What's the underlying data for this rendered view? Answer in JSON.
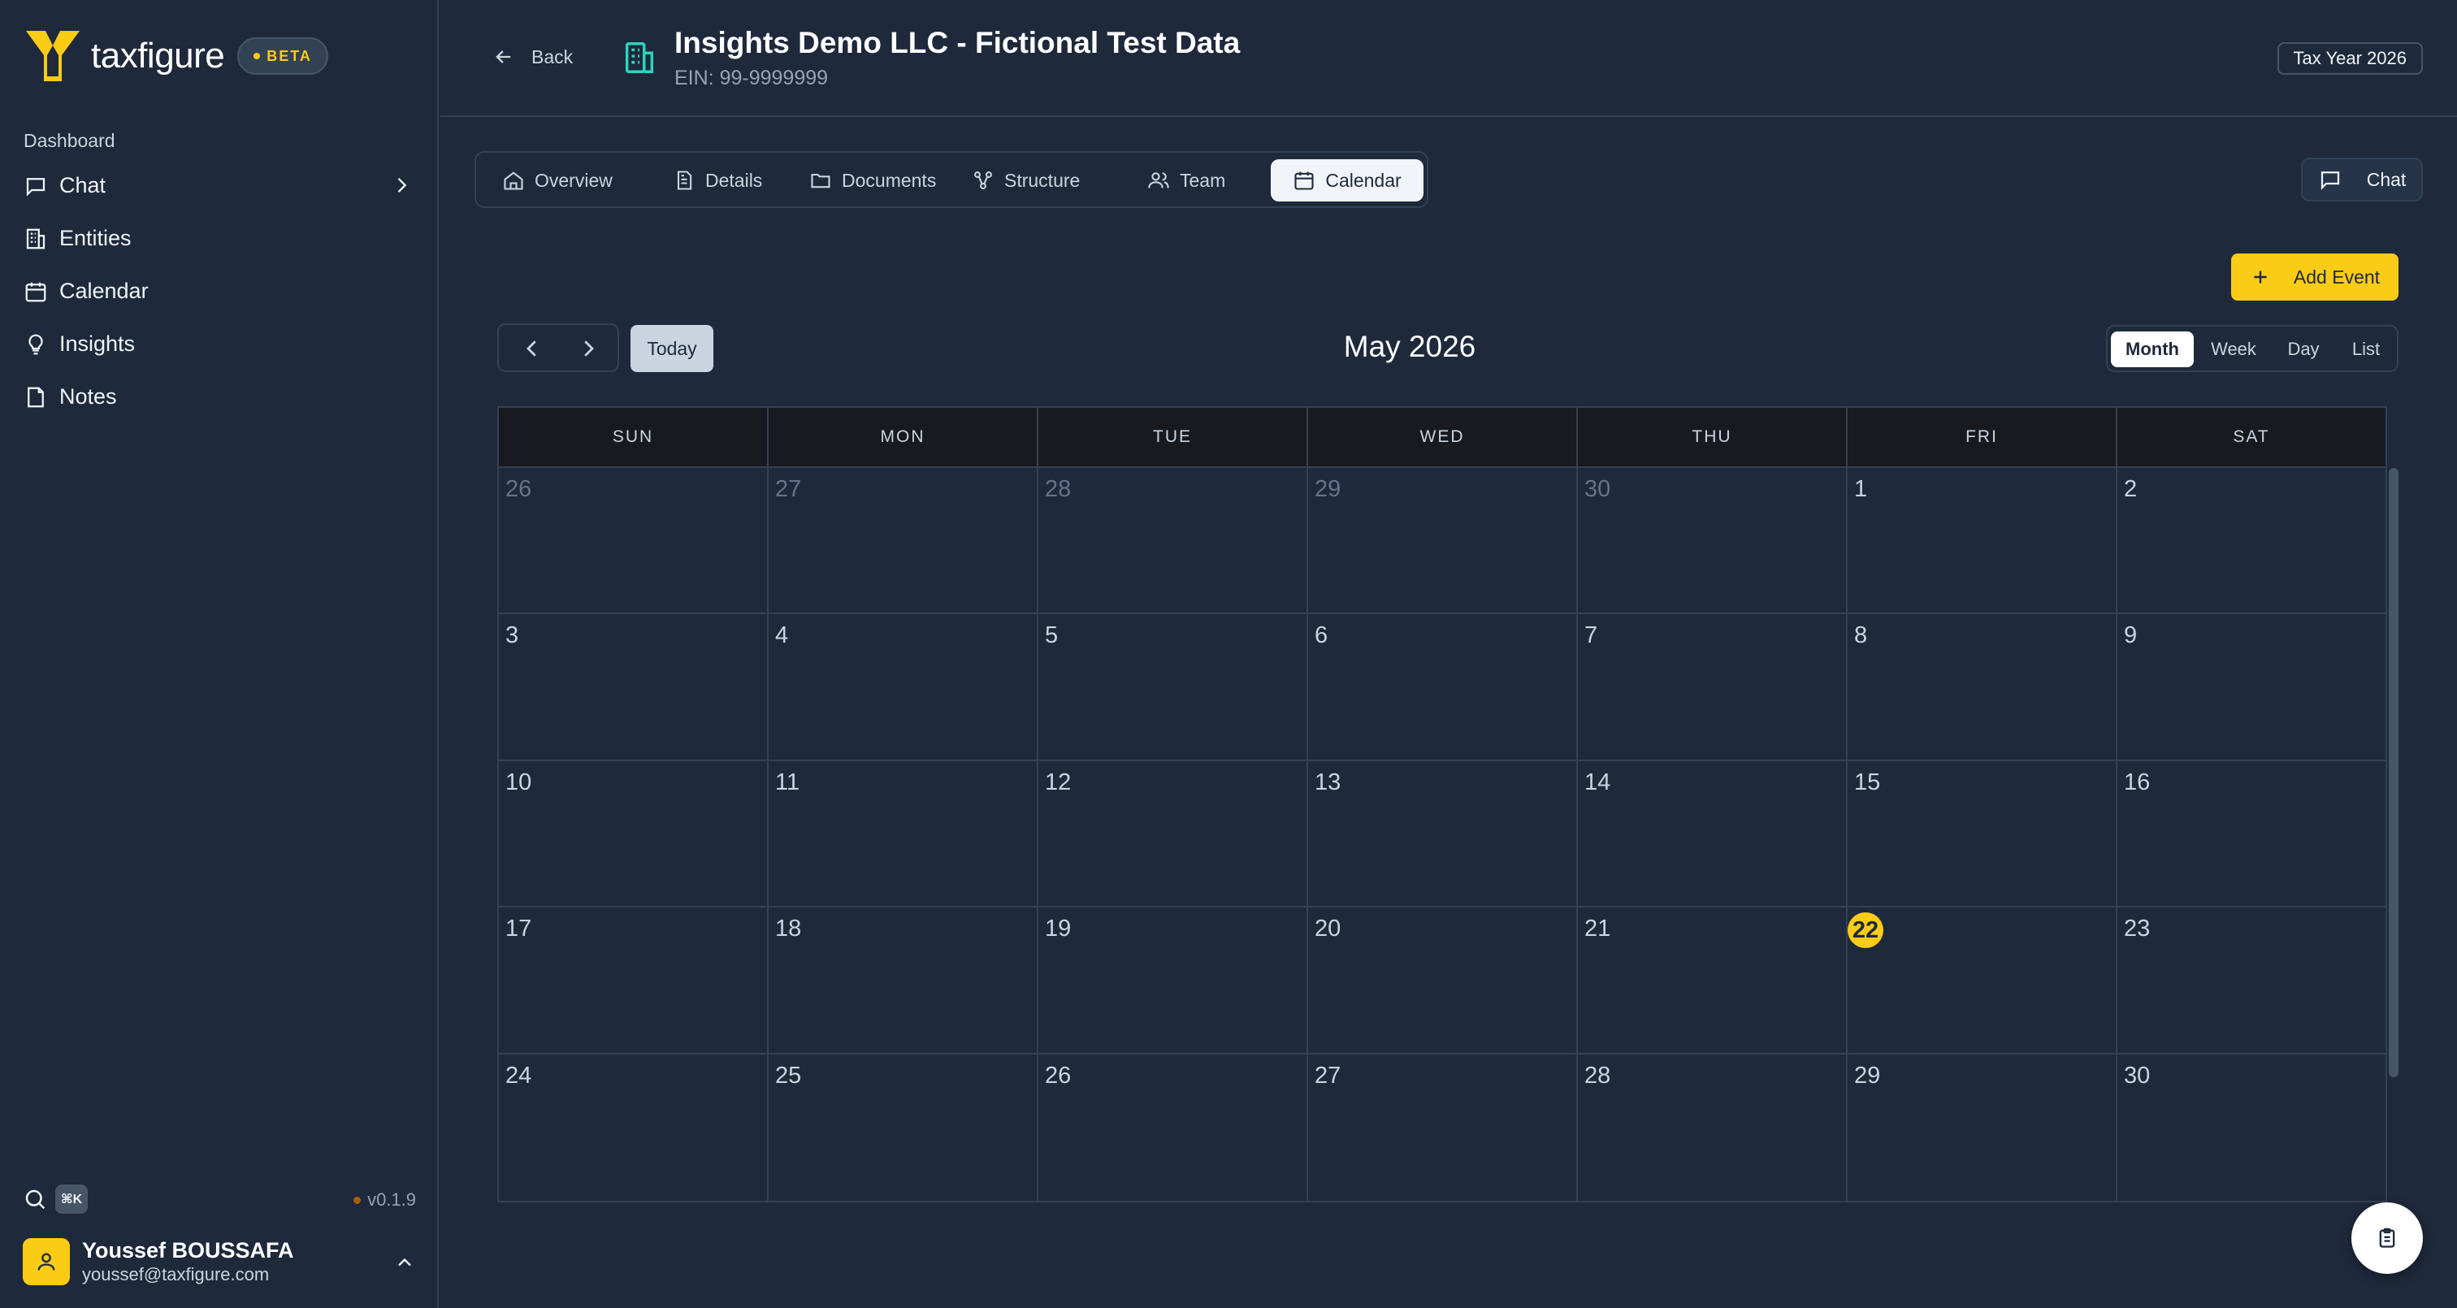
{
  "app": {
    "name": "taxfigure",
    "badge": "BETA",
    "version": "v0.1.9",
    "shortcut": "⌘K"
  },
  "sidebar": {
    "section": "Dashboard",
    "items": [
      {
        "label": "Chat",
        "icon": "message-square-icon"
      },
      {
        "label": "Entities",
        "icon": "building-icon"
      },
      {
        "label": "Calendar",
        "icon": "calendar-icon"
      },
      {
        "label": "Insights",
        "icon": "lightbulb-icon"
      },
      {
        "label": "Notes",
        "icon": "note-icon"
      }
    ]
  },
  "user": {
    "name": "Youssef BOUSSAFA",
    "email": "youssef@taxfigure.com"
  },
  "header": {
    "back_label": "Back",
    "title": "Insights Demo LLC - Fictional Test Data",
    "ein": "EIN: 99-9999999",
    "tax_year": "Tax Year 2026"
  },
  "tabs": [
    {
      "label": "Overview",
      "icon": "home-icon"
    },
    {
      "label": "Details",
      "icon": "file-text-icon"
    },
    {
      "label": "Documents",
      "icon": "folder-icon"
    },
    {
      "label": "Structure",
      "icon": "structure-icon"
    },
    {
      "label": "Team",
      "icon": "users-icon"
    },
    {
      "label": "Calendar",
      "icon": "calendar-icon",
      "active": true
    }
  ],
  "chat_button": "Chat",
  "add_event_button": "Add Event",
  "calendar": {
    "today_button": "Today",
    "month_title": "May 2026",
    "views": [
      "Month",
      "Week",
      "Day",
      "List"
    ],
    "active_view": "Month",
    "weekdays": [
      "SUN",
      "MON",
      "TUE",
      "WED",
      "THU",
      "FRI",
      "SAT"
    ],
    "weeks": [
      [
        "26",
        "27",
        "28",
        "29",
        "30",
        "1",
        "2"
      ],
      [
        "3",
        "4",
        "5",
        "6",
        "7",
        "8",
        "9"
      ],
      [
        "10",
        "11",
        "12",
        "13",
        "14",
        "15",
        "16"
      ],
      [
        "17",
        "18",
        "19",
        "20",
        "21",
        "22",
        "23"
      ],
      [
        "24",
        "25",
        "26",
        "27",
        "28",
        "29",
        "30"
      ]
    ],
    "today": "22"
  },
  "colors": {
    "accent": "#facc15",
    "background": "#1e293b",
    "grid_header": "#181a1f"
  }
}
